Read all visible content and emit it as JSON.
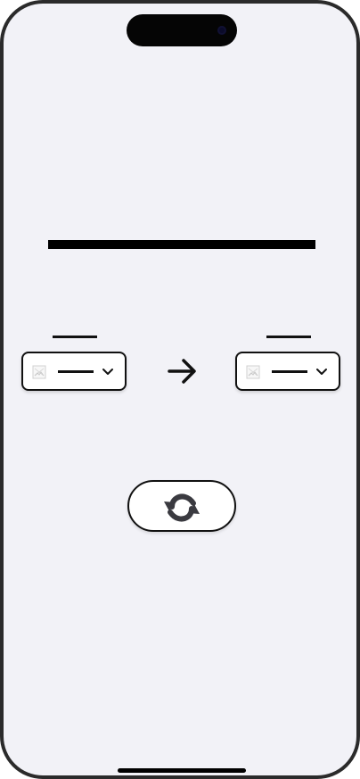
{
  "screen": {
    "background": "#f2f2f7",
    "title_text": ""
  },
  "conversion": {
    "from": {
      "label": "",
      "selected_value": "",
      "image_icon": "image-placeholder-icon",
      "dropdown_icon": "chevron-down-icon"
    },
    "direction_icon": "arrow-right-icon",
    "to": {
      "label": "",
      "selected_value": "",
      "image_icon": "image-placeholder-icon",
      "dropdown_icon": "chevron-down-icon"
    }
  },
  "actions": {
    "refresh_icon": "refresh-icon"
  },
  "colors": {
    "outline": "#111111",
    "surface": "#ffffff",
    "icon": "#3a3a40"
  }
}
